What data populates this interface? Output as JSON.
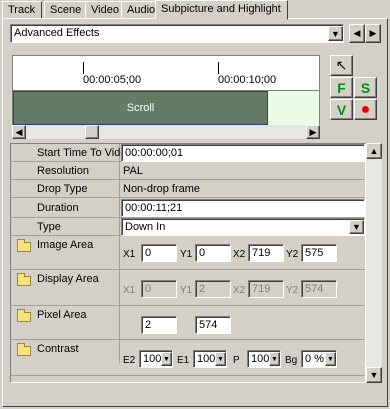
{
  "tabs": [
    {
      "label": "Track",
      "active": false
    },
    {
      "label": "Scene",
      "active": false
    },
    {
      "label": "Video",
      "active": false
    },
    {
      "label": "Audio",
      "active": false
    },
    {
      "label": "Subpicture and Highlight",
      "active": true
    }
  ],
  "effects_select": {
    "value": "Advanced Effects"
  },
  "nav": {
    "prev_icon": "left-triangle-icon",
    "next_icon": "right-triangle-icon"
  },
  "timeline": {
    "markers": [
      "00:00:05;00",
      "00:00:10;00"
    ],
    "clip_label": "Scroll",
    "scroll_position": 0.22
  },
  "tools": [
    {
      "name": "pointer-tool",
      "glyph": "↖",
      "color": "#000000"
    },
    {
      "name": "f-tool",
      "glyph": "F",
      "color": "#0a8a1e"
    },
    {
      "name": "s-tool",
      "glyph": "S",
      "color": "#0a8a1e"
    },
    {
      "name": "v-tool",
      "glyph": "V",
      "color": "#0a8a1e"
    },
    {
      "name": "record-tool",
      "glyph": "●",
      "color": "#e00000"
    }
  ],
  "properties": {
    "start_time": {
      "label": "Start Time To Video",
      "value": "00:00:00;01"
    },
    "resolution": {
      "label": "Resolution",
      "value": "PAL"
    },
    "drop_type": {
      "label": "Drop Type",
      "value": "Non-drop frame"
    },
    "duration": {
      "label": "Duration",
      "value": "00:00:11;21"
    },
    "type": {
      "label": "Type",
      "value": "Down In"
    },
    "image_area": {
      "label": "Image Area",
      "x1": "0",
      "y1": "0",
      "x2": "719",
      "y2": "575"
    },
    "display_area": {
      "label": "Display Area",
      "x1": "0",
      "y1": "2",
      "x2": "719",
      "y2": "574"
    },
    "pixel_area": {
      "label": "Pixel Area",
      "a": "2",
      "b": "574"
    },
    "contrast": {
      "label": "Contrast",
      "e2": "100",
      "e1": "100",
      "p": "100",
      "bg": "0 %"
    }
  },
  "coord_labels": {
    "x1": "X1",
    "y1": "Y1",
    "x2": "X2",
    "y2": "Y2",
    "e2": "E2",
    "e1": "E1",
    "p": "P",
    "bg": "Bg"
  }
}
